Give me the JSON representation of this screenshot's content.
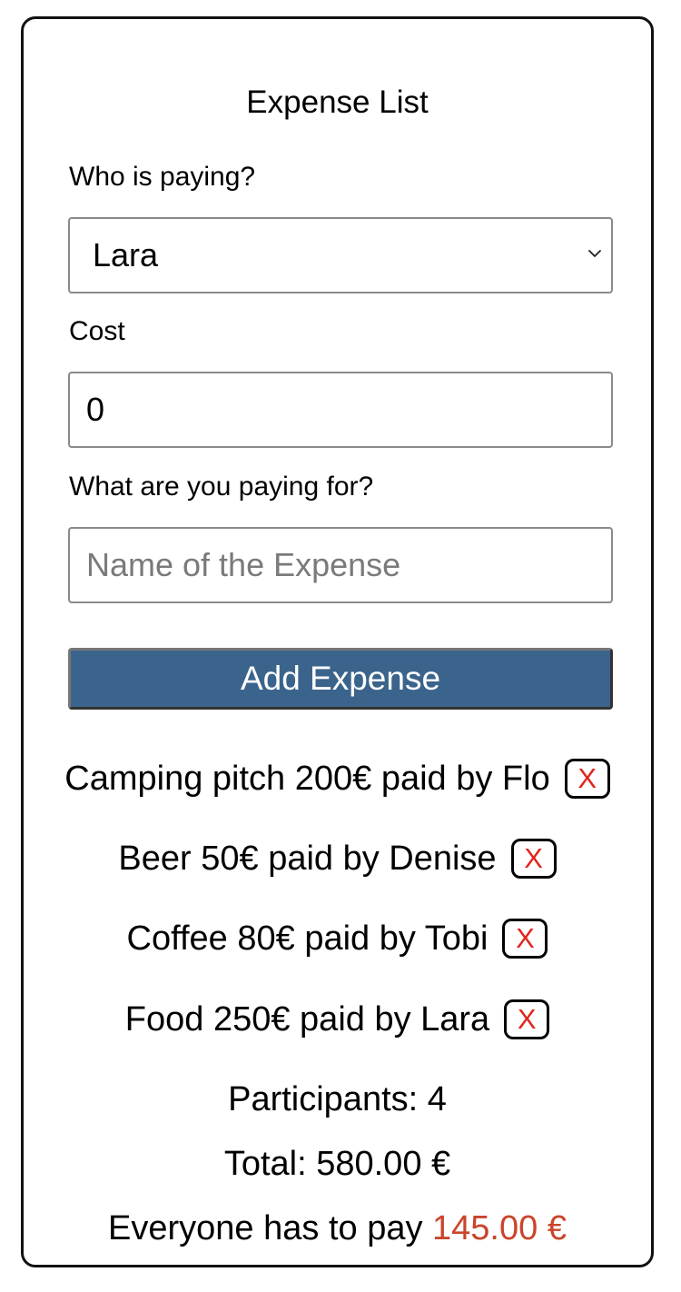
{
  "title": "Expense List",
  "payer": {
    "label": "Who is paying?",
    "selected": "Lara"
  },
  "cost": {
    "label": "Cost",
    "value": "0"
  },
  "expense_name": {
    "label": "What are you paying for?",
    "placeholder": "Name of the Expense",
    "value": ""
  },
  "add_button_label": "Add Expense",
  "expenses": [
    {
      "text": "Camping pitch 200€ paid by Flo",
      "delete_label": "X"
    },
    {
      "text": "Beer 50€ paid by Denise",
      "delete_label": "X"
    },
    {
      "text": "Coffee 80€ paid by Tobi",
      "delete_label": "X"
    },
    {
      "text": "Food 250€ paid by Lara",
      "delete_label": "X"
    }
  ],
  "summary": {
    "participants": "Participants: 4",
    "total": "Total: 580.00 €",
    "share_prefix": "Everyone has to pay",
    "share_amount": "145.00 €"
  },
  "colors": {
    "button_background": "#3b648c",
    "delete_x": "#e0251c",
    "share_amount": "#c9452b"
  },
  "icons": {
    "dropdown": "chevron-down-icon"
  }
}
